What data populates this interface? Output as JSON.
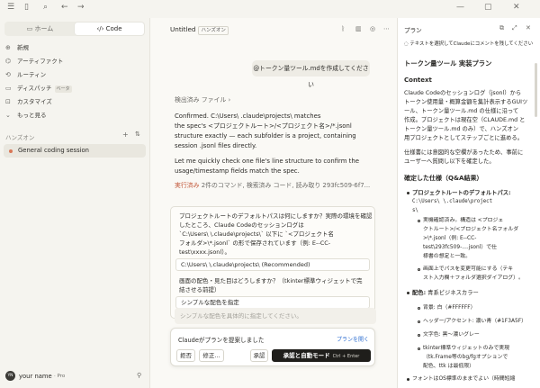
{
  "topbar": {
    "icons": [
      "menu-icon",
      "sidebar-toggle-icon",
      "search-icon",
      "back-arrow-icon",
      "forward-arrow-icon",
      "minimize-icon",
      "maximize-icon",
      "close-icon"
    ]
  },
  "sidebar": {
    "mode_tabs": [
      {
        "label": "ホーム",
        "icon": "chat-icon"
      },
      {
        "label": "Code",
        "icon": "code-icon"
      }
    ],
    "nav": [
      {
        "label": "新規",
        "icon": "plus-icon"
      },
      {
        "label": "アーティファクト",
        "icon": "artifact-icon"
      },
      {
        "label": "ルーティン",
        "icon": "routine-icon"
      },
      {
        "label": "ディスパッチ",
        "icon": "dispatch-icon",
        "badge": "ベータ"
      },
      {
        "label": "カスタマイズ",
        "icon": "customize-icon"
      },
      {
        "label": "もっと見る",
        "icon": "chevron-down-icon"
      }
    ],
    "section_label": "ハンズオン",
    "session": "General coding session",
    "user": {
      "initials": "YN",
      "name": "your name",
      "plan": "Pro"
    }
  },
  "chat": {
    "title": "Untitled",
    "title_badge": "ハンズオン",
    "user_message": "@トークン量ツール.mdを作成してください",
    "files_read": "検出済み ファイル",
    "para1": [
      "Confirmed. C:\\Users\\        .claude\\projects\\ matches",
      "the spec's <プロジェクトルート>/<プロジェクト名>/*.jsonl",
      "structure exactly — each subfolder is a project, containing",
      "session .jsonl files directly."
    ],
    "para2": [
      "Let me quickly check one file's line structure to confirm the",
      "usage/timestamp fields match the spec."
    ],
    "executed": "実行済み",
    "executed_detail": "2件のコマンド, 検索済み コード, 読み取り 293fc509-6f7...",
    "question": [
      "プロジェクトルートのデフォルトパスは何にしますか？実際の環境を確認",
      "したところ、Claude Codeのセッションログは",
      "`C:\\Users\\        \\.claude\\projects\\` 以下に `<プロジェクト名",
      "フォルダ>\\*.jsonl` の形で保存されています（例: E--CC-",
      "test\\xxxx.jsonl）。"
    ],
    "option1": "C:\\Users\\        \\.claude\\projects\\ (Recommended)",
    "question2": [
      "画面の配色・見た目はどうしますか？（tkinter標準ウィジェットで完",
      "結させる前提）"
    ],
    "option2": "シンプルな配色を指定",
    "input_placeholder": "シンプルな配色を具体的に指定してください。",
    "approval": {
      "title": "Claudeがプランを提案しました",
      "open_link": "プランを開く",
      "reject": "拒否",
      "edit": "修正...",
      "approve": "承認",
      "approve_auto": "承認と自動モード",
      "shortcut": "Ctrl + Enter"
    }
  },
  "plan": {
    "panel_title": "プラン",
    "hint": "テキストを選択してClaudeにコメントを残してください",
    "title": "トークン量ツール 実装プラン",
    "context_heading": "Context",
    "context_lines": [
      "Claude Codeのセッションログ（jsonl）から",
      "トークン使用量・概算金額を集計表示するGUIツ",
      "ール、トークン量ツール.md の仕様に沿って",
      "作成。プロジェクトは現在空（CLAUDE.md と",
      "トークン量ツール.md のみ）で、ハンズオン",
      "用プロジェクトとしてステップごとに進める。"
    ],
    "context_lines2": [
      "仕様書には意図的な空欄があったため、事前に",
      "ユーザーへ質問し以下を確定した。"
    ],
    "spec_heading": "確定した仕様（Q&A結果）",
    "items": [
      {
        "bold": "プロジェクトルートのデフォルトパス:",
        "text": [
          "C:\\Users\\        \\.claude\\project",
          "s\\"
        ]
      },
      {
        "sub": true,
        "text": [
          "実機確認済み。構造は <プロジェ",
          "クトルート>/<プロジェクト名フォルダ",
          ">\\*.jsonl（例: E--CC-",
          "test\\293fc509-....jsonl）で仕",
          "様書の想定と一致。"
        ]
      },
      {
        "sub": true,
        "text": [
          "画面上でパスを変更可能にする（テキ",
          "スト入力欄＋フォルダ選択ダイアログ）。"
        ]
      },
      {
        "bold": "配色:",
        "text": [
          "青系ビジネスカラー"
        ]
      },
      {
        "sub": true,
        "text": [
          "背景: 白（#FFFFFF）"
        ]
      },
      {
        "sub": true,
        "text": [
          "ヘッダー/アクセント: 濃い青（#1F3A5F）"
        ]
      },
      {
        "sub": true,
        "text": [
          "文字色: 黒〜濃いグレー"
        ]
      },
      {
        "sub": true,
        "text": [
          "tkinter標準ウィジェットのみで実現",
          "（tk.Frame等のbg/fgオプションで",
          "配色、ttk は最低限）"
        ]
      },
      {
        "sub": true,
        "text": [
          "フォントはOS標準のままでよい（時間短縮"
        ]
      }
    ]
  }
}
